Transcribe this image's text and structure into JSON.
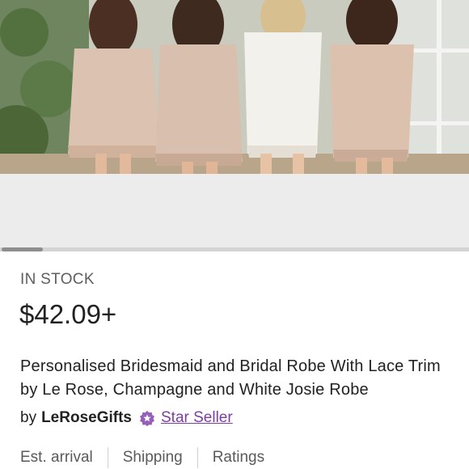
{
  "product": {
    "stock_status": "IN STOCK",
    "price": "$42.09+",
    "title": "Personalised Bridesmaid and Bridal Robe With Lace Trim by Le Rose, Champagne and White Josie Robe",
    "seller_prefix": "by",
    "seller_name": "LeRoseGifts",
    "seller_badge": "Star Seller"
  },
  "tabs": [
    "Est. arrival",
    "Shipping",
    "Ratings"
  ],
  "image": {
    "description_icon": "product-photo"
  },
  "colors": {
    "accent": "#7b3fa3",
    "badge_bg": "#9560b8",
    "grey_band": "#ececec"
  }
}
